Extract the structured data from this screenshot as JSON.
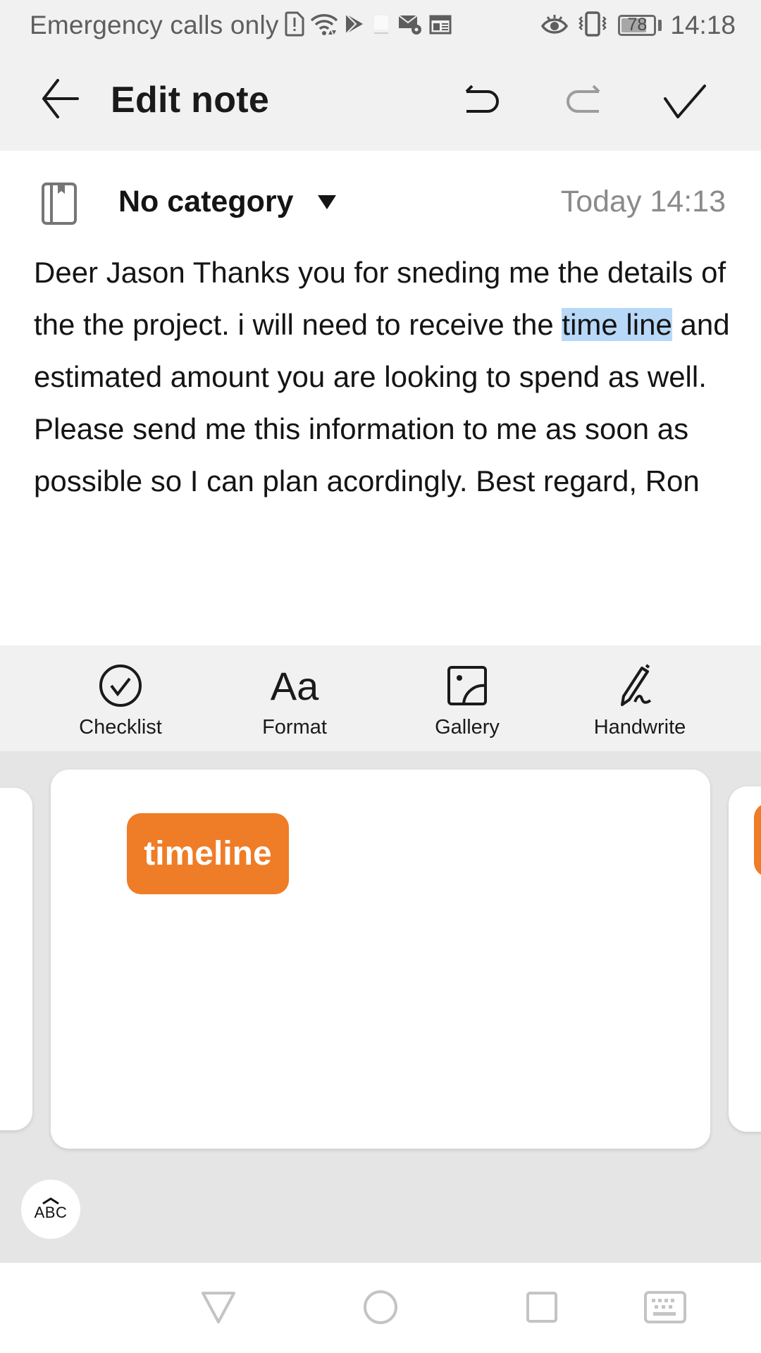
{
  "status_bar": {
    "carrier_text": "Emergency calls only",
    "icons": [
      "sim-alert-icon",
      "wifi-icon",
      "play-store-icon",
      "app-notification-icon",
      "mail-settings-icon",
      "news-icon",
      "eye-comfort-icon",
      "vibrate-icon",
      "battery-icon"
    ],
    "battery_level": "78",
    "battery_fraction": 0.78,
    "time": "14:18"
  },
  "header": {
    "title": "Edit note",
    "back_icon": "arrow-left-icon",
    "undo_icon": "undo-icon",
    "redo_icon": "redo-icon",
    "redo_enabled": false,
    "save_icon": "checkmark-icon"
  },
  "meta": {
    "category_icon": "notebook-icon",
    "category": "No category",
    "date": "Today 14:13"
  },
  "note": {
    "text_before": "Deer Jason Thanks you for sneding me the details of the the project. i will need to receive the ",
    "selected_text": "time line",
    "text_after": " and estimated amount you are looking to spend as well. Please send me this information to me as soon as possible so I can plan acordingly. Best regard, Ron"
  },
  "toolbar": {
    "items": [
      {
        "label": "Checklist",
        "icon": "checklist-icon"
      },
      {
        "label": "Format",
        "icon": "format-text-icon"
      },
      {
        "label": "Gallery",
        "icon": "gallery-icon"
      },
      {
        "label": "Handwrite",
        "icon": "handwrite-icon"
      }
    ]
  },
  "sticker_panel": {
    "suggestion": "timeline",
    "accent_color": "#ef7c26",
    "abc_button_label": "ABC"
  },
  "nav_bar": {
    "buttons": [
      "back-triangle-icon",
      "home-circle-icon",
      "recents-square-icon",
      "keyboard-icon"
    ]
  }
}
